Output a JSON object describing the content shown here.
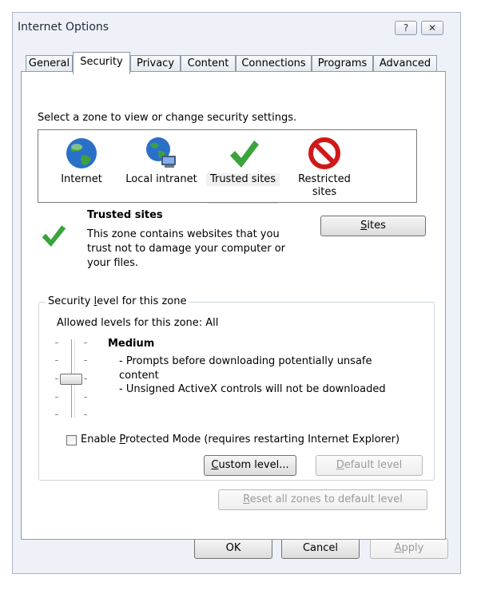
{
  "window": {
    "title": "Internet Options",
    "help_glyph": "?",
    "close_glyph": "✕"
  },
  "tabs": [
    {
      "label": "General"
    },
    {
      "label": "Security"
    },
    {
      "label": "Privacy"
    },
    {
      "label": "Content"
    },
    {
      "label": "Connections"
    },
    {
      "label": "Programs"
    },
    {
      "label": "Advanced"
    }
  ],
  "security": {
    "zone_prompt": "Select a zone to view or change security settings.",
    "zones": [
      {
        "label": "Internet",
        "icon": "globe-icon"
      },
      {
        "label": "Local intranet",
        "icon": "intranet-globe-icon"
      },
      {
        "label": "Trusted sites",
        "icon": "green-check-icon"
      },
      {
        "label_line1": "Restricted",
        "label_line2": "sites",
        "icon": "no-entry-icon"
      }
    ],
    "selected_zone": {
      "title": "Trusted sites",
      "desc_line1": "This zone contains websites that you",
      "desc_line2": "trust not to damage your computer or",
      "desc_line3": "your files.",
      "icon": "green-check-icon"
    },
    "sites_button": {
      "accel": "S",
      "rest": "ites"
    },
    "level_group": {
      "legend_pre": "Security ",
      "legend_accel": "l",
      "legend_post": "evel for this zone",
      "allowed": "Allowed levels for this zone: All",
      "level_name": "Medium",
      "bullet1_line1": "- Prompts before downloading potentially unsafe",
      "bullet1_line2": "content",
      "bullet2": "- Unsigned ActiveX controls will not be downloaded",
      "slider_level": "Medium"
    },
    "protected_mode": {
      "checked": false,
      "pre": "Enable ",
      "accel": "P",
      "post": "rotected Mode (requires restarting Internet Explorer)"
    },
    "custom_level": {
      "accel": "C",
      "rest": "ustom level..."
    },
    "default_level": {
      "accel": "D",
      "rest": "efault level"
    },
    "reset_all": {
      "accel": "R",
      "rest": "eset all zones to default level"
    }
  },
  "footer": {
    "ok": "OK",
    "cancel": "Cancel",
    "apply_accel": "A",
    "apply_rest": "pply"
  },
  "colors": {
    "check_green": "#3aa33a",
    "no_red": "#d01818",
    "globe_blue": "#2a70c8"
  }
}
